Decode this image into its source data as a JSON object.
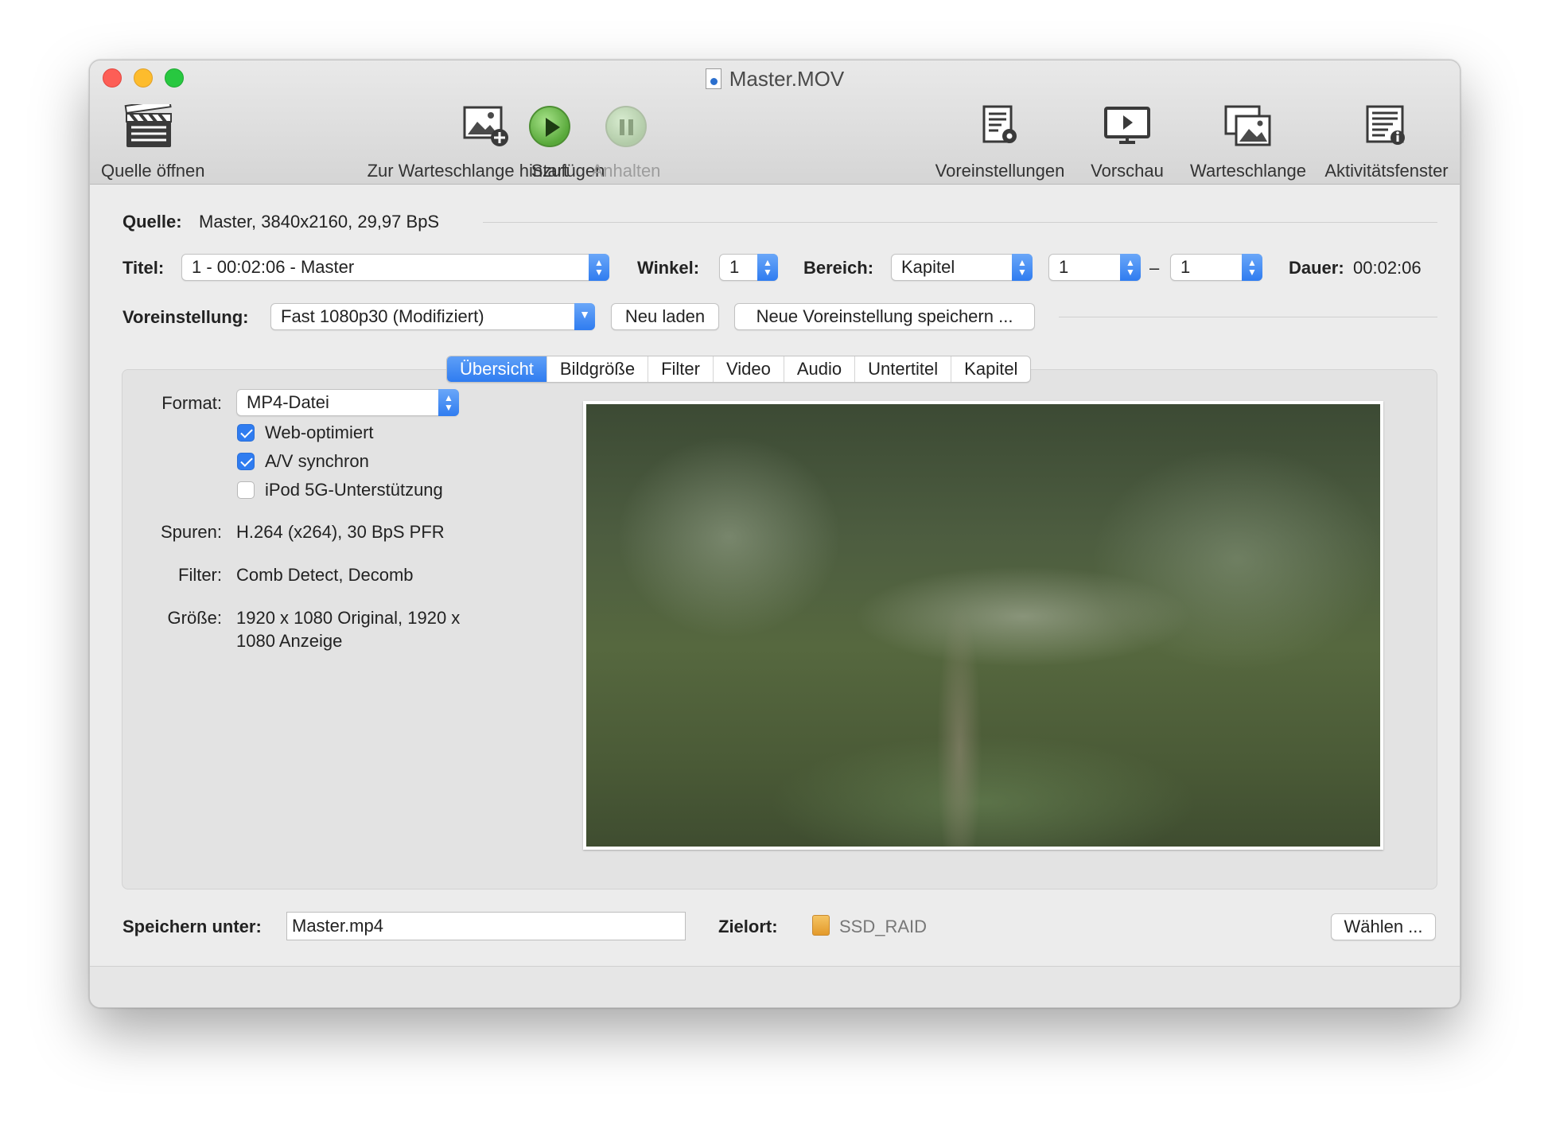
{
  "window": {
    "title": "Master.MOV"
  },
  "toolbar": {
    "open_source": "Quelle öffnen",
    "add_queue": "Zur Warteschlange hinzufügen",
    "start": "Start",
    "pause": "Anhalten",
    "presets": "Voreinstellungen",
    "preview": "Vorschau",
    "queue": "Warteschlange",
    "activity": "Aktivitätsfenster"
  },
  "source": {
    "label": "Quelle:",
    "value": "Master, 3840x2160, 29,97 BpS"
  },
  "title_row": {
    "title_label": "Titel:",
    "title_value": "1 - 00:02:06 - Master",
    "angle_label": "Winkel:",
    "angle_value": "1",
    "range_label": "Bereich:",
    "range_value": "Kapitel",
    "range_from": "1",
    "range_dash": "–",
    "range_to": "1",
    "duration_label": "Dauer:",
    "duration_value": "00:02:06"
  },
  "preset_row": {
    "label": "Voreinstellung:",
    "value": "Fast 1080p30 (Modifiziert)",
    "reload": "Neu laden",
    "save_new": "Neue Voreinstellung speichern ..."
  },
  "tabs": [
    "Übersicht",
    "Bildgröße",
    "Filter",
    "Video",
    "Audio",
    "Untertitel",
    "Kapitel"
  ],
  "summary": {
    "format_label": "Format:",
    "format_value": "MP4-Datei",
    "web_optimized": "Web-optimiert",
    "av_sync": "A/V synchron",
    "ipod": "iPod 5G-Unterstützung",
    "tracks_label": "Spuren:",
    "tracks_value": "H.264 (x264), 30 BpS PFR",
    "filter_label": "Filter:",
    "filter_value": "Comb Detect, Decomb",
    "size_label": "Größe:",
    "size_value_line1": "1920 x 1080 Original, 1920 x",
    "size_value_line2": "1080 Anzeige"
  },
  "save_row": {
    "label": "Speichern unter:",
    "filename": "Master.mp4",
    "dest_label": "Zielort:",
    "dest_value": "SSD_RAID",
    "choose": "Wählen ..."
  },
  "colors": {
    "accent": "#2f7cf0",
    "close": "#fd5e56",
    "minimize": "#fdbc2d",
    "maximize": "#28c840"
  }
}
